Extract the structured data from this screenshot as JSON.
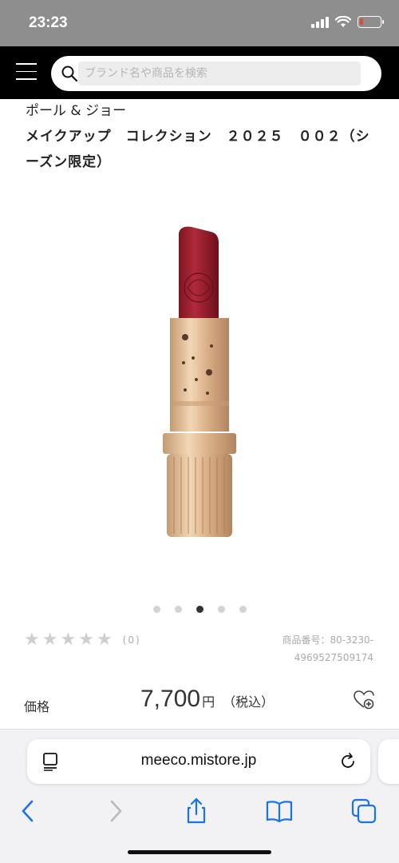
{
  "status_bar": {
    "time": "23:23",
    "battery_level": 0.15,
    "battery_color": "#e3483a"
  },
  "header": {
    "menu_icon": "hamburger-icon",
    "search": {
      "placeholder": "ブランド名や商品を検索",
      "value": ""
    }
  },
  "product": {
    "brand": "ポール & ジョー",
    "title": "メイクアップ　コレクション　２０２５　００２（シーズン限定）",
    "image_alt": "リップスティック",
    "carousel": {
      "total": 5,
      "active_index": 2
    },
    "rating": {
      "stars": 0,
      "max_stars": 5,
      "review_count_label": "(0)"
    },
    "sku_label": "商品番号：80-3230-4969527509174",
    "price": {
      "label": "価格",
      "value": "7,700",
      "unit": "円",
      "tax_note": "（税込）"
    },
    "wishlist_icon": "heart-plus-icon"
  },
  "browser": {
    "url": "meeco.mistore.jp",
    "toolbar": [
      "back-icon",
      "forward-icon",
      "share-icon",
      "bookmarks-icon",
      "tabs-icon"
    ],
    "accent_color": "#1a73e8"
  }
}
